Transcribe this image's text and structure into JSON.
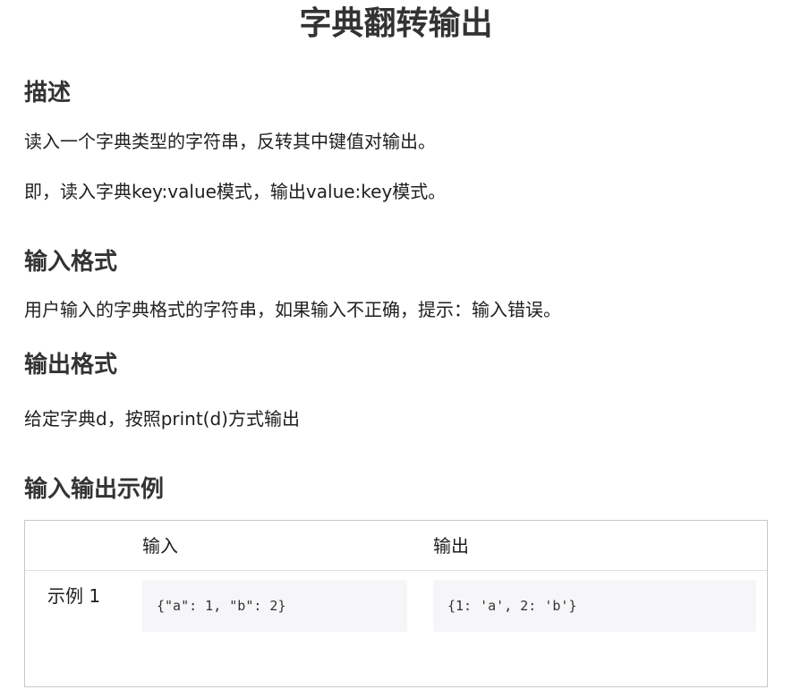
{
  "title": "字典翻转输出",
  "sections": {
    "description": {
      "heading": "描述",
      "lines": [
        "读入一个字典类型的字符串，反转其中键值对输出。",
        "即，读入字典key:value模式，输出value:key模式。"
      ]
    },
    "input_format": {
      "heading": "输入格式",
      "text": "用户输入的字典格式的字符串，如果输入不正确，提示：输入错误。"
    },
    "output_format": {
      "heading": "输出格式",
      "text": "给定字典d，按照print(d)方式输出"
    },
    "examples": {
      "heading": "输入输出示例",
      "columns": [
        "",
        "输入",
        "输出"
      ],
      "rows": [
        {
          "label": "示例 1",
          "input": "{\"a\": 1, \"b\": 2}",
          "output": "{1: 'a', 2: 'b'}"
        }
      ]
    }
  }
}
